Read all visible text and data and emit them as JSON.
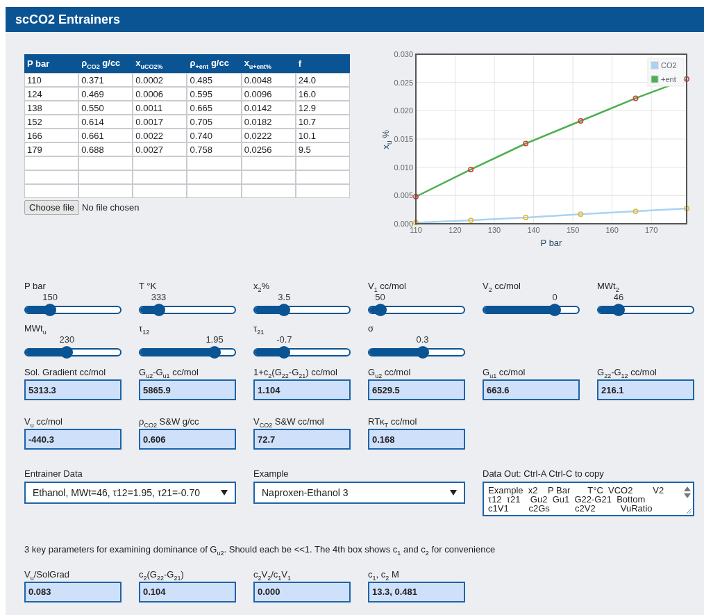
{
  "window": {
    "title": "scCO2 Entrainers"
  },
  "table": {
    "columns": [
      "P bar",
      "ρ$_{CO2}$ g/cc",
      "x$_{uCO2%}$",
      "ρ$_{+ent}$ g/cc",
      "x$_{u+ent%}$",
      "f"
    ],
    "rows": [
      {
        "kind": "data",
        "cells": [
          "110",
          "0.371",
          "0.0002",
          "0.485",
          "0.0048",
          "24.0"
        ]
      },
      {
        "kind": "data",
        "cells": [
          "124",
          "0.469",
          "0.0006",
          "0.595",
          "0.0096",
          "16.0"
        ]
      },
      {
        "kind": "data",
        "cells": [
          "138",
          "0.550",
          "0.0011",
          "0.665",
          "0.0142",
          "12.9"
        ]
      },
      {
        "kind": "data",
        "cells": [
          "152",
          "0.614",
          "0.0017",
          "0.705",
          "0.0182",
          "10.7"
        ]
      },
      {
        "kind": "data",
        "cells": [
          "166",
          "0.661",
          "0.0022",
          "0.740",
          "0.0222",
          "10.1"
        ]
      },
      {
        "kind": "data",
        "cells": [
          "179",
          "0.688",
          "0.0027",
          "0.758",
          "0.0256",
          "9.5"
        ]
      },
      {
        "kind": "blank"
      },
      {
        "kind": "blank"
      },
      {
        "kind": "blank"
      }
    ]
  },
  "file_input": {
    "button": "Choose file",
    "status": "No file chosen"
  },
  "chart": {
    "chart_data": {
      "type": "line",
      "xlabel": "P bar",
      "ylabel": "x$_{u}$ %",
      "x": [
        110,
        124,
        138,
        152,
        166,
        179
      ],
      "series": [
        {
          "name": "CO2",
          "color": "#a9d3f2",
          "marker": {
            "shape": "circle",
            "color": "#e8b923"
          },
          "values": [
            0.0002,
            0.0006,
            0.0011,
            0.0017,
            0.0022,
            0.0027
          ]
        },
        {
          "name": "+ent",
          "color": "#4caf50",
          "marker": {
            "shape": "circle",
            "color": "#d9383a"
          },
          "values": [
            0.0048,
            0.0096,
            0.0142,
            0.0182,
            0.0222,
            0.0256
          ]
        }
      ],
      "grid": true,
      "legend": true,
      "xlim": [
        110,
        179
      ],
      "ylim": [
        0,
        0.03
      ],
      "xticks": [
        110,
        120,
        130,
        140,
        150,
        160,
        170
      ],
      "yticks": [
        {
          "value": 0,
          "label": "0.000"
        },
        {
          "value": 0.005,
          "label": "0.005"
        },
        {
          "value": 0.01,
          "label": "0.010"
        },
        {
          "value": 0.015,
          "label": "0.015"
        },
        {
          "value": 0.02,
          "label": "0.020"
        },
        {
          "value": 0.025,
          "label": "0.025"
        },
        {
          "value": 0.03,
          "label": "0.030"
        }
      ]
    }
  },
  "sliders": [
    {
      "label": "P bar",
      "value": "150",
      "level": 0.23
    },
    {
      "label": "T °K",
      "value": "333",
      "level": 0.16
    },
    {
      "label": "x$_{2}$%",
      "value": "3.5",
      "level": 0.29
    },
    {
      "label": "V$_{1}$ cc/mol",
      "value": "50",
      "level": 0.07
    },
    {
      "label": "V$_{2}$ cc/mol",
      "value": "0",
      "level": 0.78
    },
    {
      "label": "MWt$_{2}$",
      "value": "46",
      "level": 0.18
    },
    {
      "label": "MWt$_{u}$",
      "value": "230",
      "level": 0.43
    },
    {
      "label": "τ$_{12}$",
      "value": "1.95",
      "level": 0.82
    },
    {
      "label": "τ$_{21}$",
      "value": "-0.7",
      "level": 0.29
    },
    {
      "label": "σ",
      "value": "0.3",
      "level": 0.57
    }
  ],
  "outputs": [
    {
      "label": "Sol. Gradient cc/mol",
      "value": "5313.3"
    },
    {
      "label": "G$_{u2}$-G$_{u1}$ cc/mol",
      "value": "5865.9"
    },
    {
      "label": "1+c$_{2}$(G$_{22}$-G$_{21}$) cc/mol",
      "value": "1.104"
    },
    {
      "label": "G$_{u2}$ cc/mol",
      "value": "6529.5"
    },
    {
      "label": "G$_{u1}$ cc/mol",
      "value": "663.6"
    },
    {
      "label": "G$_{22}$-G$_{12}$ cc/mol",
      "value": "216.1"
    },
    {
      "label": "V$_{u}$ cc/mol",
      "value": "-440.3"
    },
    {
      "label": "ρ$_{CO2}$ S&W g/cc",
      "value": "0.606"
    },
    {
      "label": "V$_{CO2}$ S&W cc/mol",
      "value": "72.7"
    },
    {
      "label": "RTκ$_{T}$ cc/mol",
      "value": "0.168"
    }
  ],
  "selects": [
    {
      "label": "Entrainer Data",
      "value": "Ethanol, MWt=46, τ12=1.95, τ21=-0.70"
    },
    {
      "label": "Example",
      "value": "Naproxen-Ethanol 3"
    }
  ],
  "data_out": {
    "label": "Data Out: Ctrl-A Ctrl-C to copy",
    "lines": [
      "Example  x2    P Bar       T°C  VCO2        V2",
      "τ12  τ21    Gu2  Gu1  G22-G21  Bottom",
      "c1V1        c2Gs          c2V2          VuRatio"
    ]
  },
  "note": "3 key parameters for examining dominance of G$_{u2}$. Should each be <<1. The 4th box shows c$_{1}$ and c$_{2}$ for convenience",
  "key_outputs": [
    {
      "label": "V$_{u}$/SolGrad",
      "value": "0.083"
    },
    {
      "label": "c$_{2}$(G$_{22}$-G$_{21}$)",
      "value": "0.104"
    },
    {
      "label": "c$_{2}$V$_{2}$/c$_{1}$V$_{1}$",
      "value": "0.000"
    },
    {
      "label": "c$_{1}$, c$_{2}$ M",
      "value": "13.3, 0.481"
    }
  ]
}
